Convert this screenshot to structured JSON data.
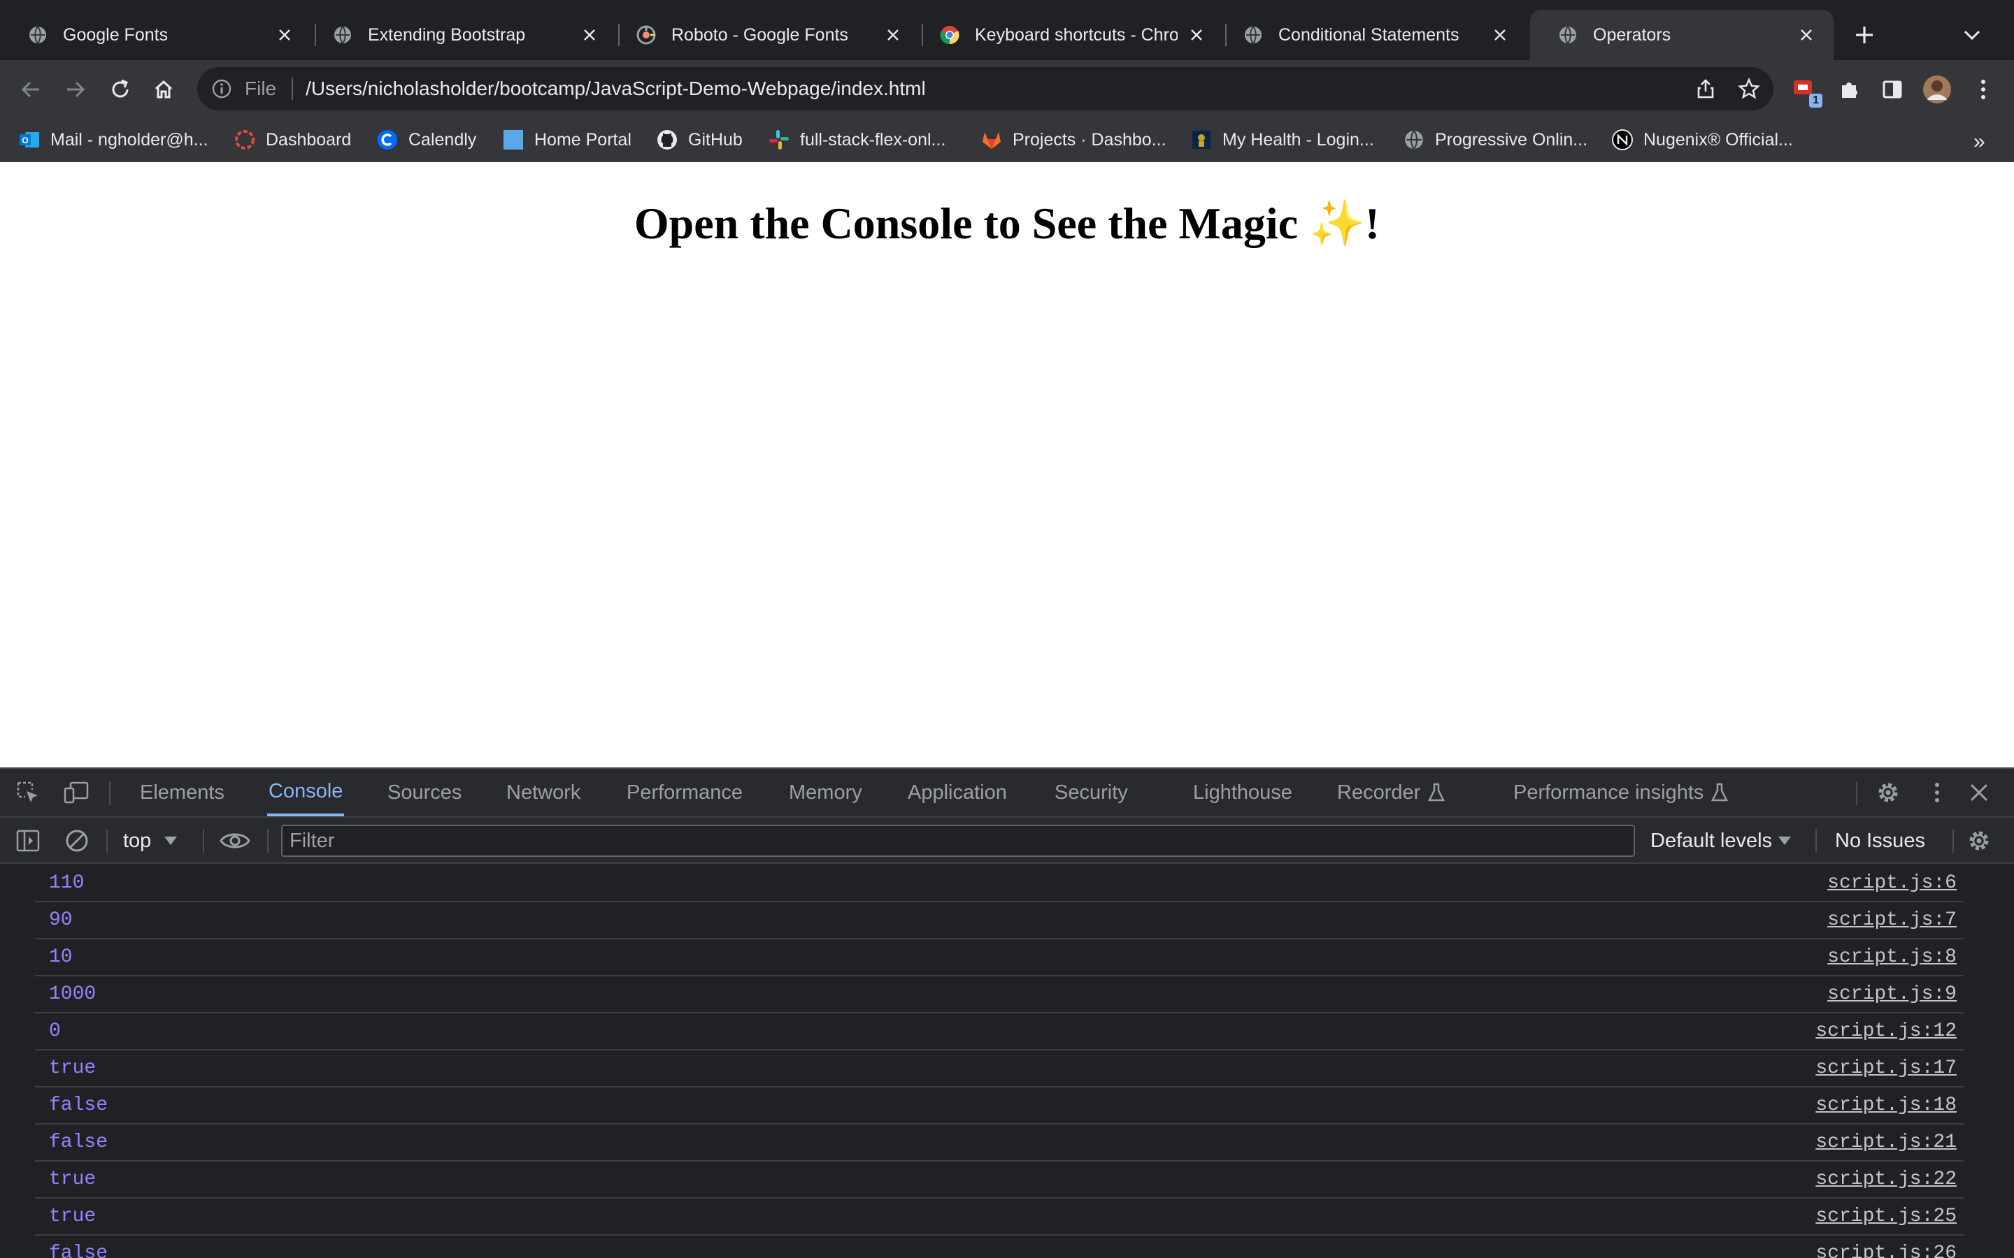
{
  "tabs": [
    {
      "title": "Google Fonts",
      "icon": "globe-icon",
      "active": false
    },
    {
      "title": "Extending Bootstrap",
      "icon": "globe-icon",
      "active": false
    },
    {
      "title": "Roboto - Google Fonts",
      "icon": "google-fonts-icon",
      "active": false
    },
    {
      "title": "Keyboard shortcuts - Chrome",
      "icon": "chrome-icon",
      "active": false
    },
    {
      "title": "Conditional Statements",
      "icon": "globe-icon",
      "active": false
    },
    {
      "title": "Operators",
      "icon": "globe-icon",
      "active": true
    }
  ],
  "omnibox": {
    "scheme_label": "File",
    "url": "/Users/nicholasholder/bootcamp/JavaScript-Demo-Webpage/index.html"
  },
  "extensions": {
    "badge_count": "1"
  },
  "bookmarks": [
    {
      "label": "Mail - ngholder@h...",
      "icon": "outlook-icon"
    },
    {
      "label": "Dashboard",
      "icon": "dashboard-icon"
    },
    {
      "label": "Calendly",
      "icon": "calendly-icon"
    },
    {
      "label": "Home Portal",
      "icon": "folder-icon"
    },
    {
      "label": "GitHub",
      "icon": "github-icon"
    },
    {
      "label": "full-stack-flex-onl...",
      "icon": "slack-icon"
    },
    {
      "label": "Projects · Dashbo...",
      "icon": "gitlab-icon"
    },
    {
      "label": "My Health - Login...",
      "icon": "health-icon"
    },
    {
      "label": "Progressive Onlin...",
      "icon": "globe-icon"
    },
    {
      "label": "Nugenix® Official...",
      "icon": "nugenix-icon"
    }
  ],
  "page": {
    "heading": "Open the Console to See the Magic ✨!"
  },
  "devtools": {
    "tabs": [
      "Elements",
      "Console",
      "Sources",
      "Network",
      "Performance",
      "Memory",
      "Application",
      "Security",
      "Lighthouse",
      "Recorder",
      "Performance insights"
    ],
    "active_tab": "Console",
    "context": "top",
    "filter_placeholder": "Filter",
    "levels": "Default levels",
    "issues": "No Issues"
  },
  "console_logs": [
    {
      "value": "110",
      "source": "script.js:6"
    },
    {
      "value": "90",
      "source": "script.js:7"
    },
    {
      "value": "10",
      "source": "script.js:8"
    },
    {
      "value": "1000",
      "source": "script.js:9"
    },
    {
      "value": "0",
      "source": "script.js:12"
    },
    {
      "value": "true",
      "source": "script.js:17"
    },
    {
      "value": "false",
      "source": "script.js:18"
    },
    {
      "value": "false",
      "source": "script.js:21"
    },
    {
      "value": "true",
      "source": "script.js:22"
    },
    {
      "value": "true",
      "source": "script.js:25"
    },
    {
      "value": "false",
      "source": "script.js:26"
    }
  ],
  "colors": {
    "console_value": "#9980ff",
    "accent": "#8ab4f8",
    "chrome_dark": "#202124",
    "toolbar": "#35363a"
  }
}
